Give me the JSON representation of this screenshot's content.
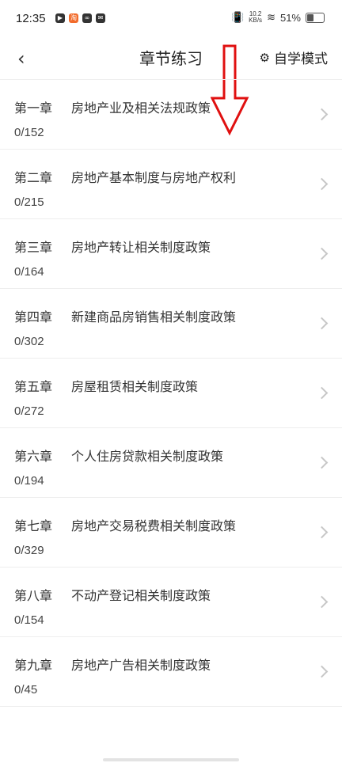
{
  "status_bar": {
    "time": "12:35",
    "net_speed_value": "10.2",
    "net_speed_unit": "KB/s",
    "battery": "51%"
  },
  "header": {
    "title": "章节练习",
    "mode_label": "自学模式"
  },
  "chapters": [
    {
      "number": "第一章",
      "name": "房地产业及相关法规政策",
      "progress": "0/152"
    },
    {
      "number": "第二章",
      "name": "房地产基本制度与房地产权利",
      "progress": "0/215"
    },
    {
      "number": "第三章",
      "name": "房地产转让相关制度政策",
      "progress": "0/164"
    },
    {
      "number": "第四章",
      "name": "新建商品房销售相关制度政策",
      "progress": "0/302"
    },
    {
      "number": "第五章",
      "name": "房屋租赁相关制度政策",
      "progress": "0/272"
    },
    {
      "number": "第六章",
      "name": "个人住房贷款相关制度政策",
      "progress": "0/194"
    },
    {
      "number": "第七章",
      "name": "房地产交易税费相关制度政策",
      "progress": "0/329"
    },
    {
      "number": "第八章",
      "name": "不动产登记相关制度政策",
      "progress": "0/154"
    },
    {
      "number": "第九章",
      "name": "房地产广告相关制度政策",
      "progress": "0/45"
    }
  ]
}
